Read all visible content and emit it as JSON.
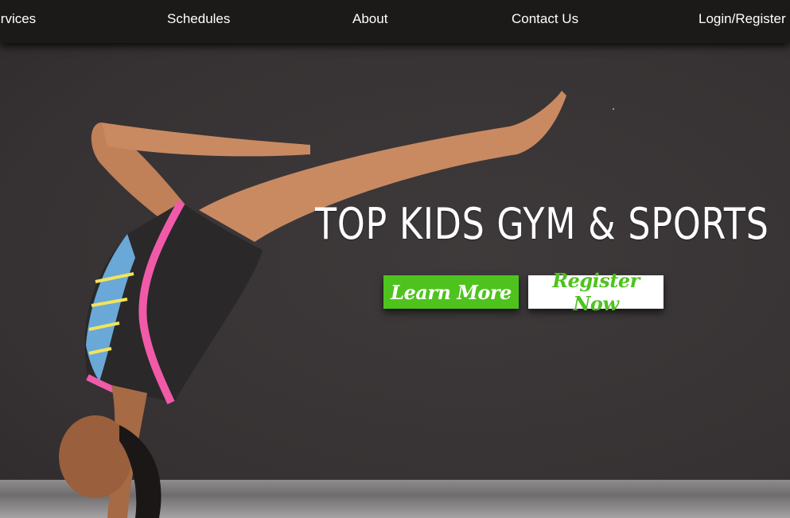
{
  "nav": {
    "items": [
      {
        "label": "Services"
      },
      {
        "label": "Schedules"
      },
      {
        "label": "About"
      },
      {
        "label": "Contact Us"
      },
      {
        "label": "Login/Register"
      }
    ]
  },
  "hero": {
    "title": "TOP KIDS GYM & SPORTS",
    "learn_more_label": "Learn More",
    "register_now_label": "Register Now"
  },
  "colors": {
    "nav_background": "#1b1a19",
    "hero_background": "#3a3637",
    "accent_green": "#4ec31d",
    "leotard_pink": "#f05aa8"
  }
}
